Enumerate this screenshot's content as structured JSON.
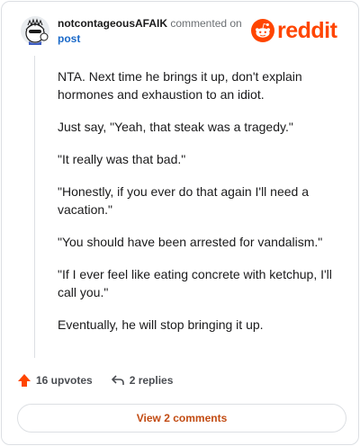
{
  "comment": {
    "username": "notcontageousAFAIK",
    "action_text": "commented on",
    "post_link": "post",
    "paragraphs": [
      "NTA. Next time he brings it up, don't explain hormones and exhaustion to an idiot.",
      "Just say, \"Yeah, that steak was a tragedy.\"",
      "\"It really was that bad.\"",
      "\"Honestly, if you ever do that again I'll need a vacation.\"",
      "\"You should have been arrested for vandalism.\"",
      "\"If I ever feel like eating concrete with ketchup, I'll call you.\"",
      "Eventually, he will stop bringing it up."
    ]
  },
  "brand": {
    "wordmark": "reddit",
    "color": "#ff4500",
    "icon": "reddit-logo-icon"
  },
  "footer": {
    "upvotes": "16 upvotes",
    "upvote_icon": "upvote-arrow-icon",
    "replies": "2 replies",
    "reply_icon": "reply-arrow-icon",
    "view_comments": "View 2 comments"
  }
}
